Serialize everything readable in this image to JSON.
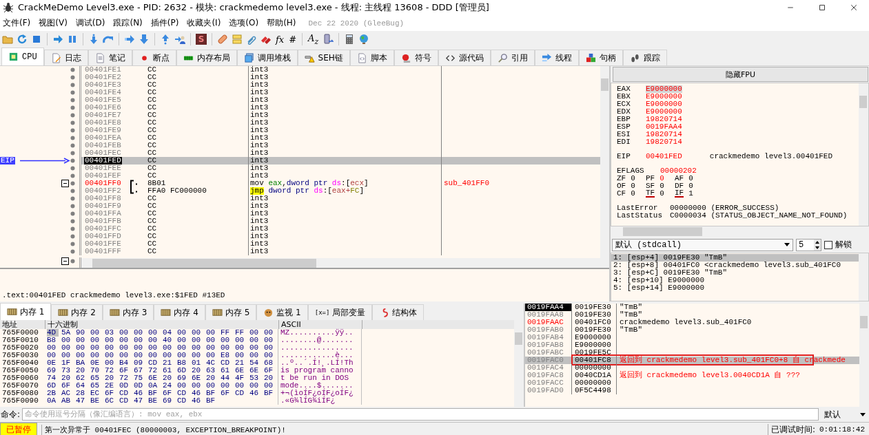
{
  "window": {
    "title": "CrackMeDemo Level3.exe - PID: 2632 - 模块: crackmedemo level3.exe - 线程: 主线程 13608 - DDD [管理员]"
  },
  "menu": [
    "文件(F)",
    "视图(V)",
    "调试(D)",
    "跟踪(N)",
    "插件(P)",
    "收藏夹(I)",
    "选项(O)",
    "帮助(H)"
  ],
  "build_info": "Dec 22 2020 (GleeBug)",
  "toolbar": [
    {
      "kind": "folder"
    },
    {
      "kind": "restart"
    },
    {
      "kind": "stop"
    },
    {
      "kind": "separator"
    },
    {
      "kind": "run"
    },
    {
      "kind": "pause"
    },
    {
      "kind": "separator"
    },
    {
      "kind": "step_into"
    },
    {
      "kind": "step_over"
    },
    {
      "kind": "separator"
    },
    {
      "kind": "trace_into"
    },
    {
      "kind": "trace_over"
    },
    {
      "kind": "separator"
    },
    {
      "kind": "till_return"
    },
    {
      "kind": "user_code"
    },
    {
      "kind": "separator"
    },
    {
      "kind": "letter",
      "text": "S"
    },
    {
      "kind": "separator"
    },
    {
      "kind": "patch"
    },
    {
      "kind": "comment"
    },
    {
      "kind": "link"
    },
    {
      "kind": "bookmark"
    },
    {
      "kind": "glyph",
      "text": "fx"
    },
    {
      "kind": "glyph",
      "text": "#"
    },
    {
      "kind": "separator"
    },
    {
      "kind": "glyph",
      "text": "A$_{z}$"
    },
    {
      "kind": "device"
    },
    {
      "kind": "separator"
    },
    {
      "kind": "calculator"
    },
    {
      "kind": "globe"
    }
  ],
  "tabs": [
    {
      "label": "CPU",
      "kind": "chip",
      "selected": true
    },
    {
      "label": "日志",
      "kind": "log",
      "selected": false
    },
    {
      "label": "笔记",
      "kind": "notes",
      "selected": false
    },
    {
      "label": "断点",
      "kind": "breakpoint",
      "selected": false
    },
    {
      "label": "内存布局",
      "kind": "memmap",
      "selected": false
    },
    {
      "label": "调用堆栈",
      "kind": "callstack",
      "selected": false
    },
    {
      "label": "SEH链",
      "kind": "seh",
      "selected": false
    },
    {
      "label": "脚本",
      "kind": "script",
      "selected": false
    },
    {
      "label": "符号",
      "kind": "symbol",
      "selected": false
    },
    {
      "label": "源代码",
      "kind": "source",
      "selected": false
    },
    {
      "label": "引用",
      "kind": "references",
      "selected": false
    },
    {
      "label": "线程",
      "kind": "threads",
      "selected": false
    },
    {
      "label": "句柄",
      "kind": "handles",
      "selected": false
    },
    {
      "label": "跟踪",
      "kind": "trace",
      "selected": false
    }
  ],
  "disassembly": {
    "eip_label": "EIP",
    "trailing_fold": true,
    "rows": [
      {
        "address": "00401FE1",
        "bytes": "CC",
        "tokens": [
          {
            "text": "int3",
            "kind": "mnemonic"
          }
        ],
        "selected": false
      },
      {
        "address": "00401FE2",
        "bytes": "CC",
        "tokens": [
          {
            "text": "int3",
            "kind": "mnemonic"
          }
        ],
        "selected": false
      },
      {
        "address": "00401FE3",
        "bytes": "CC",
        "tokens": [
          {
            "text": "int3",
            "kind": "mnemonic"
          }
        ],
        "selected": false
      },
      {
        "address": "00401FE4",
        "bytes": "CC",
        "tokens": [
          {
            "text": "int3",
            "kind": "mnemonic"
          }
        ],
        "selected": false
      },
      {
        "address": "00401FE5",
        "bytes": "CC",
        "tokens": [
          {
            "text": "int3",
            "kind": "mnemonic"
          }
        ],
        "selected": false
      },
      {
        "address": "00401FE6",
        "bytes": "CC",
        "tokens": [
          {
            "text": "int3",
            "kind": "mnemonic"
          }
        ],
        "selected": false
      },
      {
        "address": "00401FE7",
        "bytes": "CC",
        "tokens": [
          {
            "text": "int3",
            "kind": "mnemonic"
          }
        ],
        "selected": false
      },
      {
        "address": "00401FE8",
        "bytes": "CC",
        "tokens": [
          {
            "text": "int3",
            "kind": "mnemonic"
          }
        ],
        "selected": false
      },
      {
        "address": "00401FE9",
        "bytes": "CC",
        "tokens": [
          {
            "text": "int3",
            "kind": "mnemonic"
          }
        ],
        "selected": false
      },
      {
        "address": "00401FEA",
        "bytes": "CC",
        "tokens": [
          {
            "text": "int3",
            "kind": "mnemonic"
          }
        ],
        "selected": false
      },
      {
        "address": "00401FEB",
        "bytes": "CC",
        "tokens": [
          {
            "text": "int3",
            "kind": "mnemonic"
          }
        ],
        "selected": false
      },
      {
        "address": "00401FEC",
        "bytes": "CC",
        "tokens": [
          {
            "text": "int3",
            "kind": "mnemonic"
          }
        ],
        "selected": false
      },
      {
        "address": "00401FED",
        "bytes": "CC",
        "tokens": [
          {
            "text": "int3",
            "kind": "mnemonic"
          }
        ],
        "eip": true,
        "selected": true
      },
      {
        "address": "00401FEE",
        "bytes": "CC",
        "tokens": [
          {
            "text": "int3",
            "kind": "mnemonic"
          }
        ],
        "selected": false
      },
      {
        "address": "00401FEF",
        "bytes": "CC",
        "tokens": [
          {
            "text": "int3",
            "kind": "mnemonic"
          }
        ],
        "selected": false
      },
      {
        "address": "00401FF0",
        "bytes": "8B01",
        "selected": false,
        "labeled": true,
        "fold": true,
        "bracket": true,
        "comment": "sub_401FF0",
        "tokens": [
          {
            "text": "mov ",
            "kind": "mnemonic"
          },
          {
            "text": "eax",
            "kind": "register"
          },
          {
            "text": ",",
            "kind": "punct"
          },
          {
            "text": "dword ptr ",
            "kind": "size"
          },
          {
            "text": "ds",
            "kind": "segment"
          },
          {
            "text": ":[",
            "kind": "punct"
          },
          {
            "text": "ecx",
            "kind": "memreg"
          },
          {
            "text": "]",
            "kind": "punct"
          }
        ]
      },
      {
        "address": "00401FF2",
        "bytes": "FFA0 FC000000",
        "selected": false,
        "tokens": [
          {
            "text": "jmp",
            "kind": "jump"
          },
          {
            "text": " dword ptr ",
            "kind": "size"
          },
          {
            "text": "ds",
            "kind": "segment"
          },
          {
            "text": ":[",
            "kind": "punct"
          },
          {
            "text": "eax+",
            "kind": "memreg"
          },
          {
            "text": "FC",
            "kind": "number"
          },
          {
            "text": "]",
            "kind": "punct"
          }
        ]
      },
      {
        "address": "00401FF8",
        "bytes": "CC",
        "tokens": [
          {
            "text": "int3",
            "kind": "mnemonic"
          }
        ],
        "selected": false
      },
      {
        "address": "00401FF9",
        "bytes": "CC",
        "tokens": [
          {
            "text": "int3",
            "kind": "mnemonic"
          }
        ],
        "selected": false
      },
      {
        "address": "00401FFA",
        "bytes": "CC",
        "tokens": [
          {
            "text": "int3",
            "kind": "mnemonic"
          }
        ],
        "selected": false
      },
      {
        "address": "00401FFB",
        "bytes": "CC",
        "tokens": [
          {
            "text": "int3",
            "kind": "mnemonic"
          }
        ],
        "selected": false
      },
      {
        "address": "00401FFC",
        "bytes": "CC",
        "tokens": [
          {
            "text": "int3",
            "kind": "mnemonic"
          }
        ],
        "selected": false
      },
      {
        "address": "00401FFD",
        "bytes": "CC",
        "tokens": [
          {
            "text": "int3",
            "kind": "mnemonic"
          }
        ],
        "selected": false
      },
      {
        "address": "00401FFE",
        "bytes": "CC",
        "tokens": [
          {
            "text": "int3",
            "kind": "mnemonic"
          }
        ],
        "selected": false
      },
      {
        "address": "00401FFF",
        "bytes": "CC",
        "tokens": [
          {
            "text": "int3",
            "kind": "mnemonic"
          }
        ],
        "selected": false
      }
    ]
  },
  "info_line": ".text:00401FED crackmedemo level3.exe:$1FED #13ED",
  "fpu_button": "隐藏FPU",
  "registers": [
    {
      "name": "EAX",
      "value": "E9000000",
      "changed": true,
      "selected": true
    },
    {
      "name": "EBX",
      "value": "E9000000",
      "changed": true,
      "selected": false
    },
    {
      "name": "ECX",
      "value": "E9000000",
      "changed": true,
      "selected": false
    },
    {
      "name": "EDX",
      "value": "E9000000",
      "changed": true,
      "selected": false
    },
    {
      "name": "EBP",
      "value": "19820714",
      "changed": true,
      "selected": false
    },
    {
      "name": "ESP",
      "value": "0019FAA4",
      "changed": true,
      "selected": false
    },
    {
      "name": "ESI",
      "value": "19820714",
      "changed": true,
      "selected": false
    },
    {
      "name": "EDI",
      "value": "19820714",
      "changed": true,
      "selected": false
    }
  ],
  "eip": {
    "name": "EIP",
    "value": "00401FED",
    "changed": true,
    "comment": "crackmedemo level3.00401FED"
  },
  "eflags": {
    "name": "EFLAGS",
    "value": "00000202",
    "changed": true
  },
  "flag_rows": [
    [
      {
        "name": "ZF",
        "value": "0",
        "changed": false,
        "marked": false
      },
      {
        "name": "PF",
        "value": "0",
        "changed": true,
        "marked": false
      },
      {
        "name": "AF",
        "value": "0",
        "changed": false,
        "marked": false
      }
    ],
    [
      {
        "name": "OF",
        "value": "0",
        "changed": false,
        "marked": false
      },
      {
        "name": "SF",
        "value": "0",
        "changed": false,
        "marked": false
      },
      {
        "name": "DF",
        "value": "0",
        "changed": false,
        "marked": false
      }
    ],
    [
      {
        "name": "CF",
        "value": "0",
        "changed": false,
        "marked": false
      },
      {
        "name": "TF",
        "value": "0",
        "changed": false,
        "marked": true
      },
      {
        "name": "IF",
        "value": "1",
        "changed": false,
        "marked": true
      }
    ]
  ],
  "last_error": {
    "name": "LastError",
    "value": "00000000 (ERROR_SUCCESS)"
  },
  "last_status": {
    "name": "LastStatus",
    "value": "C0000034 (STATUS_OBJECT_NAME_NOT_FOUND)"
  },
  "call": {
    "convention": "默认 (stdcall)",
    "count": "5",
    "unlock": {
      "label": "解锁",
      "checked": false
    },
    "args": [
      {
        "text": "1: [esp+4] 0019FE30 \"TmB\"",
        "selected": true
      },
      {
        "text": "2: [esp+8] 00401FC0 <crackmedemo level3.sub_401FC0",
        "selected": false
      },
      {
        "text": "3: [esp+C] 0019FE30 \"TmB\"",
        "selected": false
      },
      {
        "text": "4: [esp+10] E9000000",
        "selected": false
      },
      {
        "text": "5: [esp+14] E9000000",
        "selected": false
      }
    ]
  },
  "bottom_tabs": [
    {
      "label": "内存 1",
      "kind": "memory",
      "selected": true
    },
    {
      "label": "内存 2",
      "kind": "memory",
      "selected": false
    },
    {
      "label": "内存 3",
      "kind": "memory",
      "selected": false
    },
    {
      "label": "内存 4",
      "kind": "memory",
      "selected": false
    },
    {
      "label": "内存 5",
      "kind": "memory",
      "selected": false
    },
    {
      "label": "监视 1",
      "kind": "watch",
      "selected": false
    },
    {
      "label": "局部变量",
      "kind": "locals",
      "glyph": "[x=]",
      "selected": false
    },
    {
      "label": "结构体",
      "kind": "struct",
      "selected": false
    }
  ],
  "dump": {
    "columns": [
      "地址",
      "十六进制",
      "ASCII"
    ],
    "rows": [
      {
        "address": "765F0000",
        "bytes": [
          "4D",
          "5A",
          "90",
          "00",
          "03",
          "00",
          "00",
          "00",
          "04",
          "00",
          "00",
          "00",
          "FF",
          "FF",
          "00",
          "00"
        ],
        "ascii": "MZ..........ÿÿ..",
        "selected": true
      },
      {
        "address": "765F0010",
        "bytes": [
          "B8",
          "00",
          "00",
          "00",
          "00",
          "00",
          "00",
          "00",
          "40",
          "00",
          "00",
          "00",
          "00",
          "00",
          "00",
          "00"
        ],
        "ascii": "........@.......",
        "selected": false
      },
      {
        "address": "765F0020",
        "bytes": [
          "00",
          "00",
          "00",
          "00",
          "00",
          "00",
          "00",
          "00",
          "00",
          "00",
          "00",
          "00",
          "00",
          "00",
          "00",
          "00"
        ],
        "ascii": "................",
        "selected": false
      },
      {
        "address": "765F0030",
        "bytes": [
          "00",
          "00",
          "00",
          "00",
          "00",
          "00",
          "00",
          "00",
          "00",
          "00",
          "00",
          "00",
          "E8",
          "00",
          "00",
          "00"
        ],
        "ascii": "............è...",
        "selected": false
      },
      {
        "address": "765F0040",
        "bytes": [
          "0E",
          "1F",
          "BA",
          "0E",
          "00",
          "B4",
          "09",
          "CD",
          "21",
          "B8",
          "01",
          "4C",
          "CD",
          "21",
          "54",
          "68"
        ],
        "ascii": "..º..´.Í!¸.LÍ!Th",
        "selected": false
      },
      {
        "address": "765F0050",
        "bytes": [
          "69",
          "73",
          "20",
          "70",
          "72",
          "6F",
          "67",
          "72",
          "61",
          "6D",
          "20",
          "63",
          "61",
          "6E",
          "6E",
          "6F"
        ],
        "ascii": "is program canno",
        "selected": false
      },
      {
        "address": "765F0060",
        "bytes": [
          "74",
          "20",
          "62",
          "65",
          "20",
          "72",
          "75",
          "6E",
          "20",
          "69",
          "6E",
          "20",
          "44",
          "4F",
          "53",
          "20"
        ],
        "ascii": "t be run in DOS ",
        "selected": false
      },
      {
        "address": "765F0070",
        "bytes": [
          "6D",
          "6F",
          "64",
          "65",
          "2E",
          "0D",
          "0D",
          "0A",
          "24",
          "00",
          "00",
          "00",
          "00",
          "00",
          "00",
          "00"
        ],
        "ascii": "mode....$.......",
        "selected": false
      },
      {
        "address": "765F0080",
        "bytes": [
          "2B",
          "AC",
          "28",
          "EC",
          "6F",
          "CD",
          "46",
          "BF",
          "6F",
          "CD",
          "46",
          "BF",
          "6F",
          "CD",
          "46",
          "BF"
        ],
        "ascii": "+¬(ìoÍF¿oÍF¿oÍF¿",
        "selected": false
      },
      {
        "address": "765F0090",
        "bytes": [
          "0A",
          "AB",
          "47",
          "BE",
          "6C",
          "CD",
          "47",
          "BE",
          "69",
          "CD",
          "46",
          "BF"
        ],
        "ascii": ".«G¾lÍG¾iÍF¿",
        "selected": false
      }
    ]
  },
  "stack": [
    {
      "address": "0019FAA4",
      "value": "0019FE30",
      "comment": "\"TmB\"",
      "kind": "top",
      "selected": false,
      "boxed": false
    },
    {
      "address": "0019FAA8",
      "value": "0019FE30",
      "comment": "\"TmB\"",
      "kind": "data",
      "selected": false,
      "boxed": false
    },
    {
      "address": "0019FAAC",
      "value": "00401FC0",
      "comment": "crackmedemo level3.sub_401FC0",
      "kind": "frame",
      "selected": false,
      "boxed": false
    },
    {
      "address": "0019FAB0",
      "value": "0019FE30",
      "comment": "\"TmB\"",
      "kind": "data",
      "selected": false,
      "boxed": false
    },
    {
      "address": "0019FAB4",
      "value": "E9000000",
      "kind": "data",
      "selected": false,
      "boxed": false
    },
    {
      "address": "0019FAB8",
      "value": "E9000000",
      "kind": "data",
      "selected": false,
      "boxed": false
    },
    {
      "address": "0019FABC",
      "value": "0019FE5C",
      "kind": "data",
      "selected": false,
      "boxed": false
    },
    {
      "address": "0019FAC0",
      "value": "00401FC8",
      "comment": "返回到 crackmedemo level3.sub_401FC0+8 自 crackmede",
      "kind": "return",
      "selected": true,
      "boxed": true
    },
    {
      "address": "0019FAC4",
      "value": "00000000",
      "kind": "data",
      "selected": false,
      "boxed": false
    },
    {
      "address": "0019FAC8",
      "value": "0040CD1A",
      "comment": "返回到 crackmedemo level3.0040CD1A 自 ???",
      "kind": "return",
      "selected": false,
      "boxed": false
    },
    {
      "address": "0019FACC",
      "value": "00000000",
      "kind": "data",
      "selected": false,
      "boxed": false
    },
    {
      "address": "0019FAD0",
      "value": "0F5C4498",
      "kind": "data",
      "selected": false,
      "boxed": false
    }
  ],
  "command": {
    "label": "命令:",
    "placeholder": "命令使用逗号分隔（像汇编语言）: mov eax, ebx",
    "mode": "默认"
  },
  "status": {
    "state": "已暂停",
    "message": "第一次异常于 00401FEC (80000003, EXCEPTION_BREAKPOINT)!",
    "elapsed_label": "已调试时间:",
    "elapsed": "0:01:18:42"
  }
}
